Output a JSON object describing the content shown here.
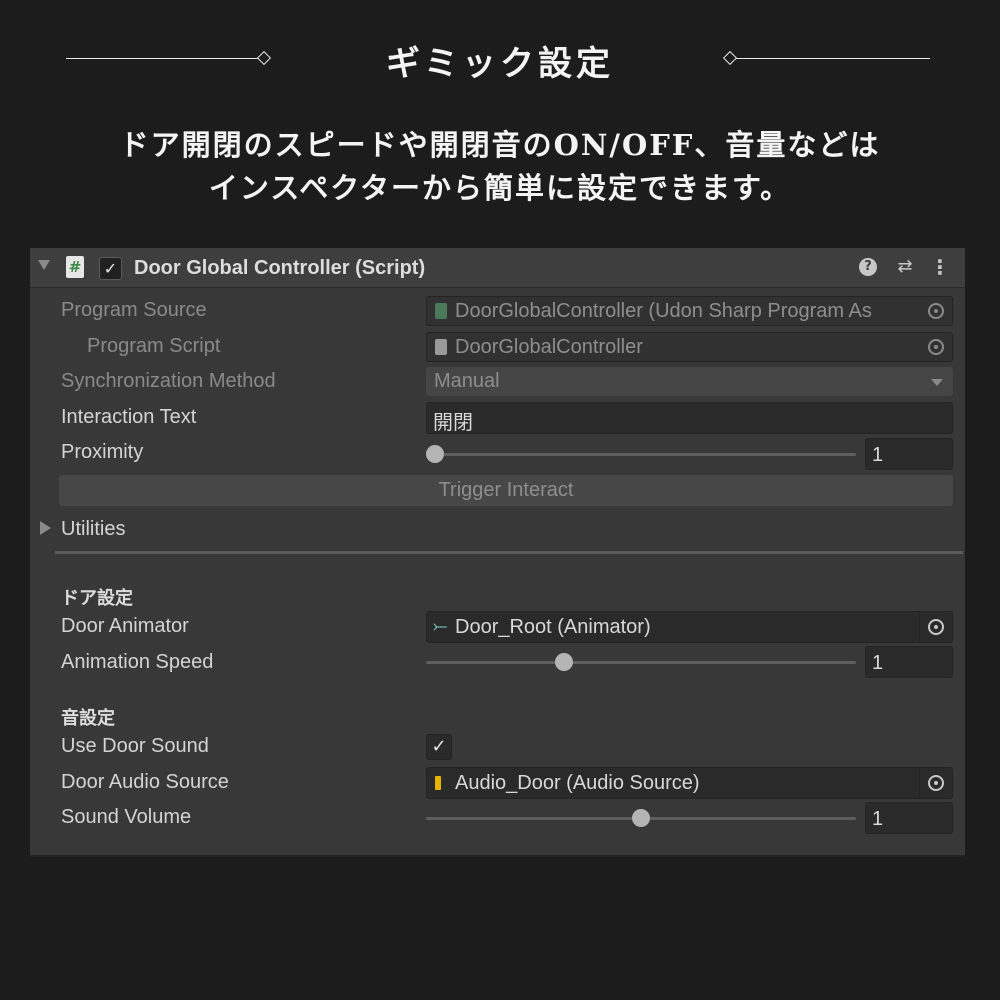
{
  "heading": {
    "title": "ギミック設定",
    "description_line1": "ドア開閉のスピードや開閉音のON/OFF、音量などは",
    "description_line2": "インスペクターから簡単に設定できます。"
  },
  "component": {
    "title": "Door Global Controller (Script)",
    "enabled": true,
    "icons": [
      "script-icon",
      "help-icon",
      "presets-icon",
      "more-icon"
    ],
    "checkbox_glyph": "✓",
    "script_glyph": "#",
    "help_glyph": "?",
    "presets_glyph": "⇄",
    "more_glyph": "⋮"
  },
  "fields": {
    "program_source": {
      "label": "Program Source",
      "value": "DoorGlobalController (Udon Sharp Program As"
    },
    "program_script": {
      "label": "Program Script",
      "value": "DoorGlobalController"
    },
    "sync_method": {
      "label": "Synchronization Method",
      "value": "Manual"
    },
    "interaction_text": {
      "label": "Interaction Text",
      "value": "開閉"
    },
    "proximity": {
      "label": "Proximity",
      "value": "1",
      "slider_fraction": 0.02
    },
    "trigger_button": {
      "label": "Trigger Interact"
    },
    "utilities": {
      "label": "Utilities"
    }
  },
  "door_section": {
    "header": "ドア設定",
    "door_animator": {
      "label": "Door Animator",
      "value": "Door_Root (Animator)",
      "icon": "animator-icon"
    },
    "animation_speed": {
      "label": "Animation Speed",
      "value": "1",
      "slider_fraction": 0.32
    }
  },
  "sound_section": {
    "header": "音設定",
    "use_door_sound": {
      "label": "Use Door Sound",
      "checked": true,
      "glyph": "✓"
    },
    "door_audio_source": {
      "label": "Door Audio Source",
      "value": "Audio_Door (Audio Source)",
      "icon": "audio-source-icon"
    },
    "sound_volume": {
      "label": "Sound Volume",
      "value": "1",
      "slider_fraction": 0.5
    }
  },
  "colors": {
    "background": "#1c1c1c",
    "panel": "#383838",
    "header": "#3e3e3e",
    "audio_icon": "#e8b400",
    "animator_icon": "#7fd4d4",
    "program_icon": "#4a7a5a"
  }
}
